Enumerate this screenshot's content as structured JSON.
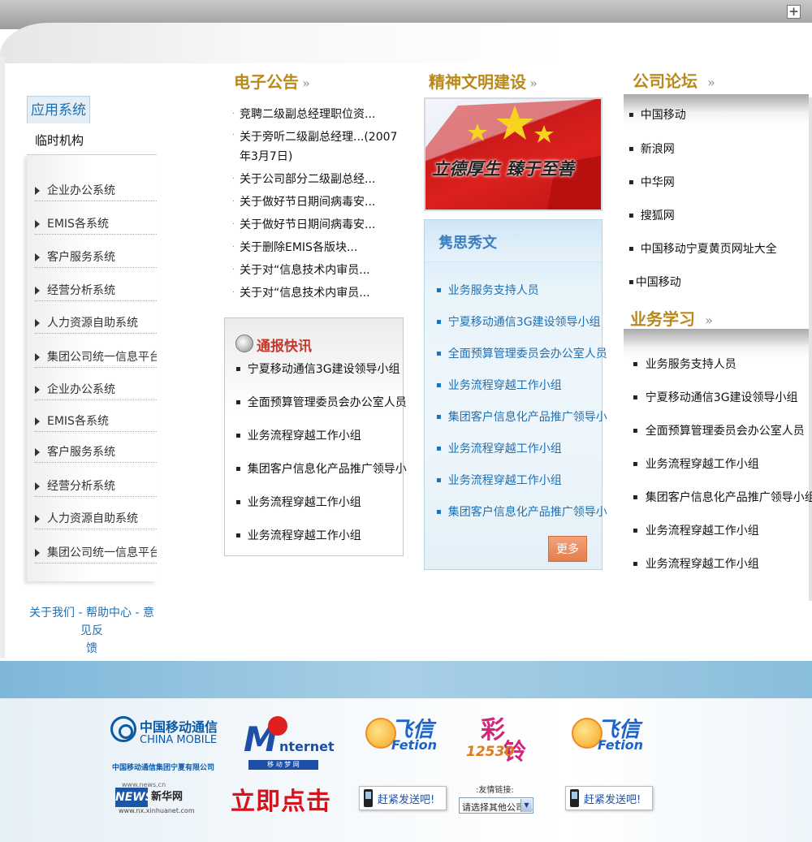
{
  "toolbar": {
    "expand_label": "+"
  },
  "sidebar": {
    "tab_label": "应用系统",
    "sub_label": "临时机构",
    "items": [
      "企业办公系统",
      "EMIS各系统",
      "客户服务系统",
      "经营分析系统",
      "人力资源自助系统",
      "集团公司统一信息平台",
      "企业办公系统",
      "EMIS各系统",
      "客户服务系统",
      "经营分析系统",
      "人力资源自助系统",
      "集团公司统一信息平台"
    ]
  },
  "footer": {
    "about": "关于我们",
    "sep": " - ",
    "help": "帮助中心",
    "feedback_a": "意见反",
    "feedback_b": "馈"
  },
  "announce": {
    "title": "电子公告",
    "raquo": "»",
    "items": [
      "竞聘二级副总经理职位资...",
      "关于旁听二级副总经理...(2007年3月7日)",
      "关于公司部分二级副总经...",
      "关于做好节日期间病毒安...",
      "关于做好节日期间病毒安...",
      "关于删除EMIS各版块...",
      "关于对“信息技术内审员...",
      "关于对“信息技术内审员..."
    ]
  },
  "flash": {
    "title": "通报快讯",
    "items": [
      "宁夏移动通信3G建设领导小组",
      "全面预算管理委员会办公室人员",
      "业务流程穿越工作小组",
      "集团客户信息化产品推广领导小",
      "业务流程穿越工作小组",
      "业务流程穿越工作小组"
    ]
  },
  "spirit": {
    "title": "精神文明建设",
    "raquo": "»",
    "banner_text": "立德厚生 臻于至善",
    "box_title": "隽思秀文",
    "items": [
      "业务服务支持人员",
      "宁夏移动通信3G建设领导小组",
      "全面预算管理委员会办公室人员",
      "业务流程穿越工作小组",
      "集团客户信息化产品推广领导小",
      "业务流程穿越工作小组",
      "业务流程穿越工作小组",
      "集团客户信息化产品推广领导小"
    ],
    "more": "更多>>"
  },
  "forum": {
    "title": "公司论坛",
    "raquo": "»",
    "items": [
      "中国移动",
      "新浪网",
      "中华网",
      "搜狐网",
      "中国移动宁夏黄页网址大全",
      "中国移动"
    ]
  },
  "study": {
    "title": "业务学习",
    "raquo": "»",
    "items": [
      "业务服务支持人员",
      "宁夏移动通信3G建设领导小组",
      "全面预算管理委员会办公室人员",
      "业务流程穿越工作小组",
      "集团客户信息化产品推广领导小组",
      "业务流程穿越工作小组",
      "业务流程穿越工作小组"
    ]
  },
  "partners": {
    "cm_cn": "中国移动通信",
    "cm_en": "CHINA MOBILE",
    "cm_sub": "中国移动通信集团宁夏有限公司",
    "news_url1": "www.news.cn",
    "news_mark": "NEWS",
    "news_cn": "新华网",
    "news_url2": "www.nx.xinhuanet.com",
    "mon_m": "M",
    "mon_net": "nternet",
    "mon_bar": "移 动 梦 网",
    "click_text": "立即点击进",
    "fetion_cn": "飞信",
    "fetion_en": "Fetion",
    "caixin_main": "彩",
    "caixin_num": "12530",
    "caixin_sub": "铃",
    "send_label": "赶紧发送吧!",
    "friend_label": ":友情链接:",
    "friend_selected": "请选择其他公司..."
  },
  "colors": {
    "accent_gold": "#b8891c",
    "link_blue": "#1f6fb3",
    "band_blue": "#8fc1de"
  }
}
